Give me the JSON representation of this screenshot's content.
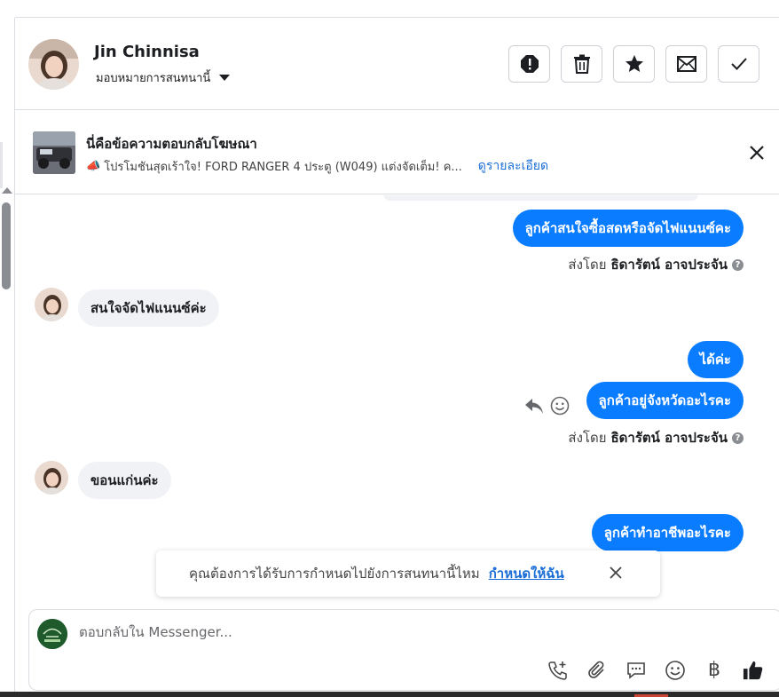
{
  "header": {
    "contact_name": "Jin Chinnisa",
    "assign_label": "มอบหมายการสนทนานี้",
    "actions": [
      {
        "icon": "alert-icon",
        "name": "mark-spam-button"
      },
      {
        "icon": "trash-icon",
        "name": "delete-button"
      },
      {
        "icon": "star-icon",
        "name": "star-button"
      },
      {
        "icon": "envelope-icon",
        "name": "mark-unread-button"
      },
      {
        "icon": "check-icon",
        "name": "mark-done-button"
      }
    ]
  },
  "ad": {
    "title": "นี่คือข้อความตอบกลับโฆษณา",
    "emoji": "📣",
    "description": "โปรโมชันสุดเร้าใจ! FORD RANGER 4 ประตู (W049) แต่งจัดเต็ม! ค...",
    "more_link": "ดูรายละเอียด"
  },
  "messages": {
    "m1": "ลูกค้าสนใจซื้อสดหรือจัดไฟแนนซ์คะ",
    "sent1_prefix": "ส่งโดย",
    "sent1_name": "ธิดารัตน์ อาจประจัน",
    "m2": "สนใจจัดไฟแนนซ์ค่ะ",
    "m3": "ได้ค่ะ",
    "m4": "ลูกค้าอยู่จังหวัดอะไรคะ",
    "sent2_prefix": "ส่งโดย",
    "sent2_name": "ธิดารัตน์ อาจประจัน",
    "m5": "ขอนแก่นค่ะ",
    "m6": "ลูกค้าทำอาชีพอะไรคะ"
  },
  "toast": {
    "text": "คุณต้องการได้รับการกำหนดไปยังการสนทนานี้ไหม",
    "link": "กำหนดให้ฉัน"
  },
  "composer": {
    "placeholder": "ตอบกลับใน Messenger...",
    "tools": [
      "phone-plus-icon",
      "paperclip-icon",
      "chat-bubble-icon",
      "smiley-icon",
      "baht-icon",
      "thumbs-up-icon"
    ],
    "baht_symbol": "฿"
  },
  "colors": {
    "accent": "#0a7cff",
    "link": "#1a6dd6",
    "incoming_bubble": "#f0f2f5"
  }
}
